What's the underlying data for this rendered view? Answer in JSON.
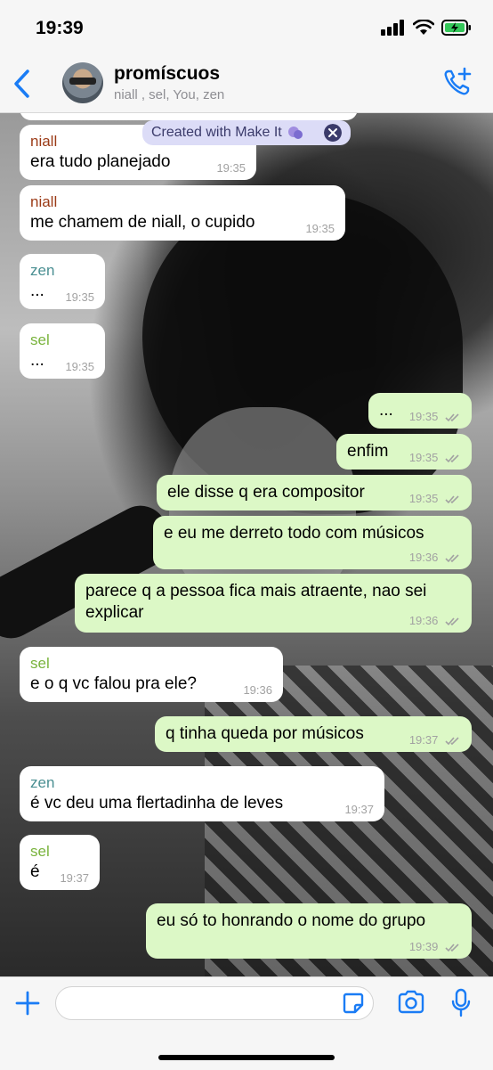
{
  "status": {
    "time": "19:39"
  },
  "header": {
    "title": "promíscuos",
    "subtitle": "niall , sel, You, zen"
  },
  "banner": {
    "label": "Created with Make It"
  },
  "messages": [
    {
      "sender": "niall",
      "text": "era tudo planejado",
      "time": "19:35"
    },
    {
      "sender": "niall",
      "text": "me chamem de niall, o cupido",
      "time": "19:35"
    },
    {
      "sender": "zen",
      "text": "...",
      "time": "19:35"
    },
    {
      "sender": "sel",
      "text": "...",
      "time": "19:35"
    },
    {
      "text": "...",
      "time": "19:35"
    },
    {
      "text": "enfim",
      "time": "19:35"
    },
    {
      "text": "ele disse q era compositor",
      "time": "19:35"
    },
    {
      "text": "e eu me derreto todo com músicos",
      "time": "19:36"
    },
    {
      "text": "parece q a pessoa fica mais atraente, nao sei explicar",
      "time": "19:36"
    },
    {
      "sender": "sel",
      "text": "e o q vc falou pra ele?",
      "time": "19:36"
    },
    {
      "text": "q tinha queda por músicos",
      "time": "19:37"
    },
    {
      "sender": "zen",
      "text": "é vc deu uma flertadinha de leves",
      "time": "19:37"
    },
    {
      "sender": "sel",
      "text": "é",
      "time": "19:37"
    },
    {
      "text": "eu só to honrando o nome do grupo",
      "time": "19:39"
    }
  ],
  "input": {
    "value": ""
  },
  "colors": {
    "accent": "#1a7cf5",
    "outgoing_bubble": "#dcf8c6",
    "incoming_bubble": "#ffffff",
    "sender_niall": "#9b3b17",
    "sender_zen": "#4a8f92",
    "sender_sel": "#79b33c"
  },
  "icons": [
    "back-chevron-icon",
    "add-call-icon",
    "plus-icon",
    "sticker-icon",
    "camera-icon",
    "microphone-icon",
    "signal-icon",
    "wifi-icon",
    "battery-icon",
    "double-check-icon",
    "close-icon"
  ]
}
